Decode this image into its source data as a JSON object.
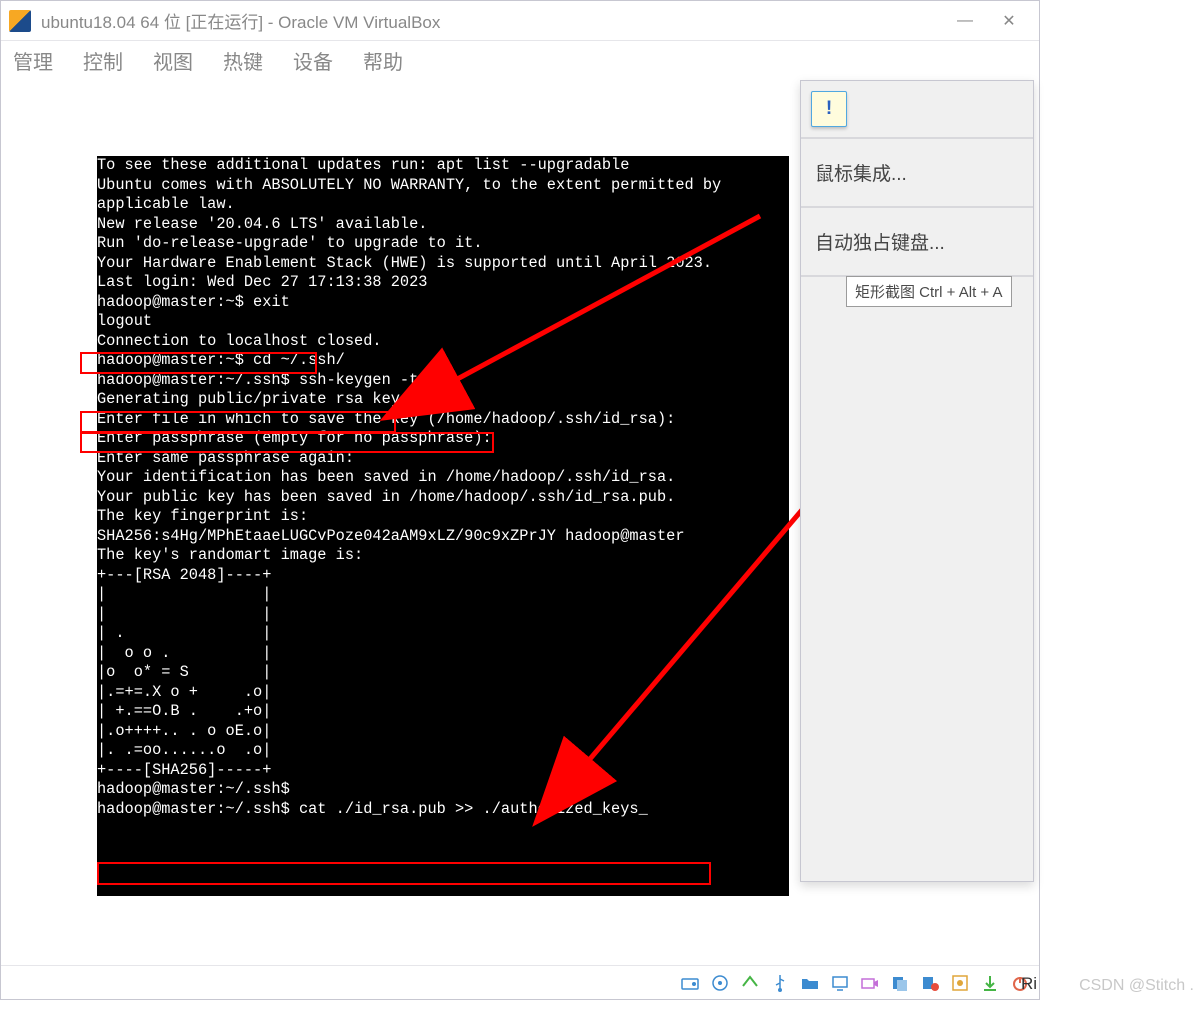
{
  "window": {
    "title": "ubuntu18.04 64 位 [正在运行] - Oracle VM VirtualBox",
    "min": "—",
    "close": "✕"
  },
  "menu": {
    "items": [
      "管理",
      "控制",
      "视图",
      "热键",
      "设备",
      "帮助"
    ]
  },
  "terminal": {
    "lines": [
      "To see these additional updates run: apt list --upgradable",
      "",
      "Ubuntu comes with ABSOLUTELY NO WARRANTY, to the extent permitted by",
      "applicable law.",
      "",
      "New release '20.04.6 LTS' available.",
      "Run 'do-release-upgrade' to upgrade to it.",
      "",
      "Your Hardware Enablement Stack (HWE) is supported until April 2023.",
      "Last login: Wed Dec 27 17:13:38 2023",
      "hadoop@master:~$ exit",
      "logout",
      "Connection to localhost closed.",
      "hadoop@master:~$ cd ~/.ssh/",
      "hadoop@master:~/.ssh$ ssh-keygen -t rsa",
      "Generating public/private rsa key pair.",
      "Enter file in which to save the key (/home/hadoop/.ssh/id_rsa):",
      "Enter passphrase (empty for no passphrase):",
      "Enter same passphrase again:",
      "Your identification has been saved in /home/hadoop/.ssh/id_rsa.",
      "Your public key has been saved in /home/hadoop/.ssh/id_rsa.pub.",
      "The key fingerprint is:",
      "SHA256:s4Hg/MPhEtaaeLUGCvPoze042aAM9xLZ/90c9xZPrJY hadoop@master",
      "The key's randomart image is:",
      "+---[RSA 2048]----+",
      "|                 |",
      "|                 |",
      "| .               |",
      "|  o o .          |",
      "|o  o* = S        |",
      "|.=+=.X o +     .o|",
      "| +.==O.B .    .+o|",
      "|.o++++.. . o oE.o|",
      "|. .=oo......o  .o|",
      "+----[SHA256]-----+",
      "hadoop@master:~/.ssh$",
      "hadoop@master:~/.ssh$ cat ./id_rsa.pub >> ./authorized_keys_"
    ]
  },
  "sidepanel": {
    "bubble_glyph": "!",
    "item1": "鼠标集成...",
    "item2": "自动独占键盘..."
  },
  "tooltip": {
    "text": "矩形截图 Ctrl + Alt + A"
  },
  "watermark": {
    "text": "CSDN @Stitch ."
  },
  "rightedge": {
    "text": "Ri"
  },
  "status_icons": [
    "hdd-icon",
    "cd-icon",
    "net-icon",
    "usb-icon",
    "folder-icon",
    "display-icon",
    "camera-icon",
    "clipboard-icon",
    "rec-icon",
    "capture-icon",
    "download-icon",
    "power-icon"
  ]
}
